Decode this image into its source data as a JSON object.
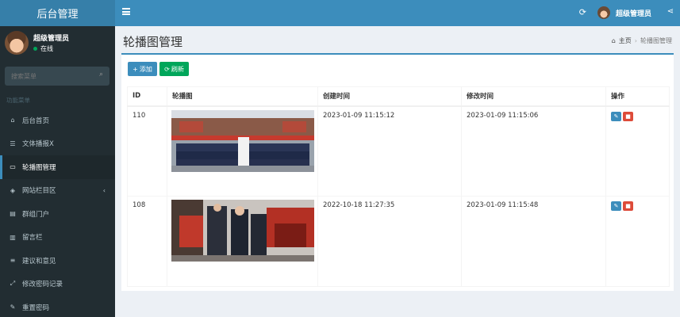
{
  "app": {
    "title": "后台管理"
  },
  "topbar": {
    "user_name": "超级管理员"
  },
  "sidebar": {
    "user_name": "超级管理员",
    "status": "在线",
    "search_placeholder": "搜索菜单",
    "menu_header": "功能菜单",
    "items": [
      {
        "label": "后台首页",
        "icon": "home-icon"
      },
      {
        "label": "文体播报X",
        "icon": "list-icon"
      },
      {
        "label": "轮播图管理",
        "icon": "image-icon",
        "active": true
      },
      {
        "label": "网站栏目区",
        "icon": "cube-icon",
        "has_submenu": true
      },
      {
        "label": "群组门户",
        "icon": "grid-icon"
      },
      {
        "label": "留言栏",
        "icon": "book-icon"
      },
      {
        "label": "建议和意见",
        "icon": "list-icon"
      },
      {
        "label": "修改密码记录",
        "icon": "link-icon"
      },
      {
        "label": "重置密码",
        "icon": "edit-icon"
      }
    ]
  },
  "content": {
    "title": "轮播图管理",
    "breadcrumb": {
      "home": "主页",
      "current": "轮播图管理"
    },
    "buttons": {
      "add": "添加",
      "refresh": "刷新"
    },
    "table": {
      "columns": [
        "ID",
        "轮播图",
        "创建时间",
        "修改时间",
        "操作"
      ],
      "rows": [
        {
          "id": "110",
          "created": "2023-01-09 11:15:12",
          "modified": "2023-01-09 11:15:06"
        },
        {
          "id": "108",
          "created": "2022-10-18 11:27:35",
          "modified": "2023-01-09 11:15:48"
        }
      ]
    }
  },
  "colors": {
    "primary": "#3c8dbc",
    "success": "#00a65a",
    "danger": "#dd4b39",
    "sidebar": "#222d32"
  }
}
